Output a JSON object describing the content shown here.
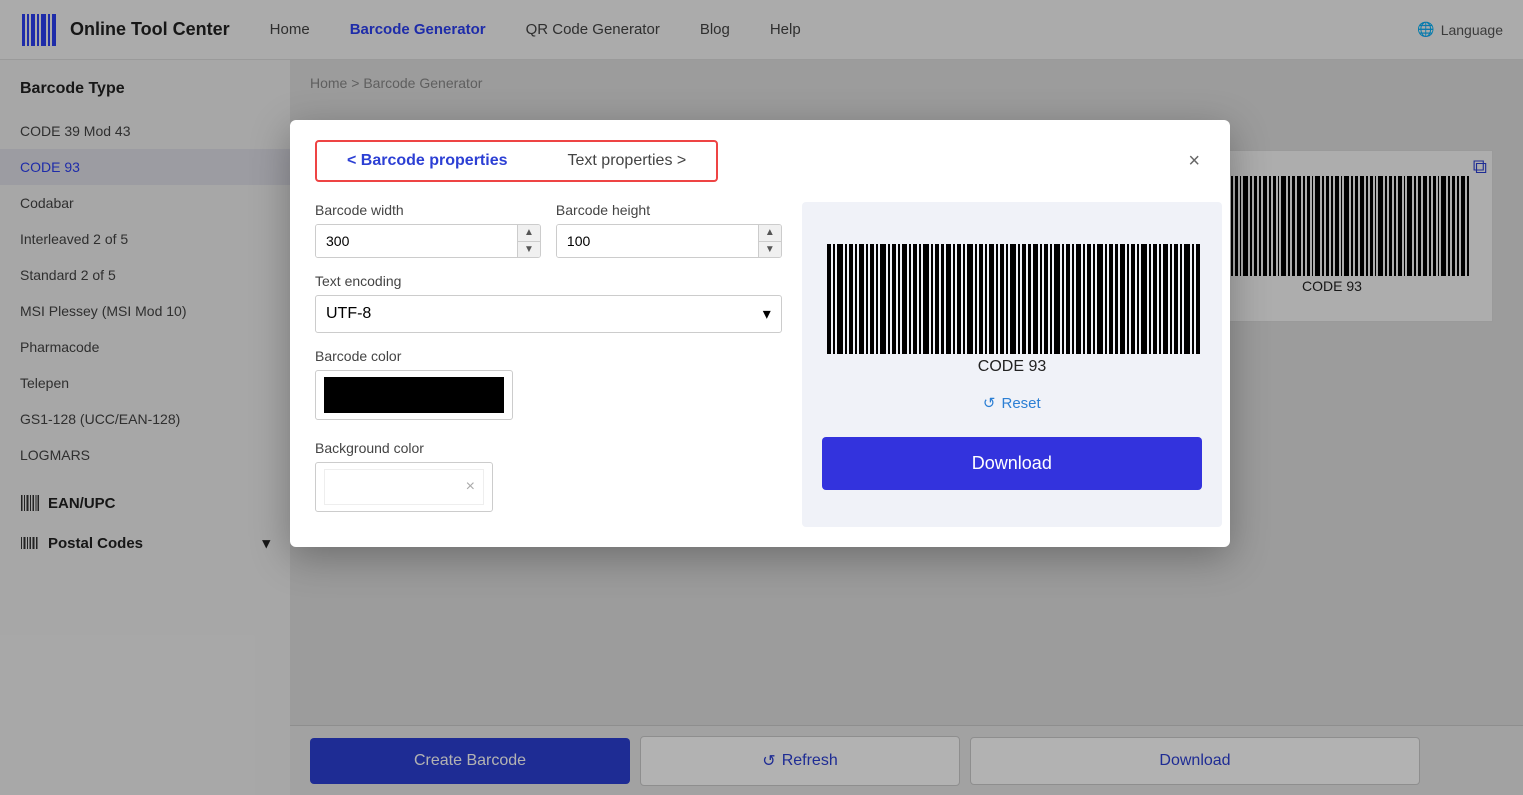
{
  "header": {
    "logo_text": "Online Tool Center",
    "nav": [
      {
        "label": "Home",
        "active": false
      },
      {
        "label": "Barcode Generator",
        "active": true
      },
      {
        "label": "QR Code Generator",
        "active": false
      },
      {
        "label": "Blog",
        "active": false
      },
      {
        "label": "Help",
        "active": false
      }
    ],
    "language_label": "Language"
  },
  "sidebar": {
    "title": "Barcode Type",
    "items": [
      {
        "label": "CODE 39 Mod 43",
        "active": false
      },
      {
        "label": "CODE 93",
        "active": true
      },
      {
        "label": "Codabar",
        "active": false
      },
      {
        "label": "Interleaved 2 of 5",
        "active": false
      },
      {
        "label": "Standard 2 of 5",
        "active": false
      },
      {
        "label": "MSI Plessey (MSI Mod 10)",
        "active": false
      },
      {
        "label": "Pharmacode",
        "active": false
      },
      {
        "label": "Telepen",
        "active": false
      },
      {
        "label": "GS1-128 (UCC/EAN-128)",
        "active": false
      },
      {
        "label": "LOGMARS",
        "active": false
      }
    ],
    "sections": [
      {
        "label": "EAN/UPC"
      },
      {
        "label": "Postal Codes",
        "has_arrow": true
      }
    ]
  },
  "breadcrumb": {
    "home": "Home",
    "separator": ">",
    "current": "Barcode Generator"
  },
  "modal": {
    "tab_barcode": "< Barcode properties",
    "tab_text": "Text properties >",
    "close_label": "×",
    "barcode_width_label": "Barcode width",
    "barcode_width_value": "300",
    "barcode_height_label": "Barcode height",
    "barcode_height_value": "100",
    "text_encoding_label": "Text encoding",
    "text_encoding_value": "UTF-8",
    "barcode_color_label": "Barcode color",
    "background_color_label": "Background color",
    "bg_clear_icon": "×",
    "barcode_name": "CODE 93",
    "reset_label": "Reset",
    "download_label": "Download"
  },
  "bottom_bar": {
    "create_label": "Create Barcode",
    "refresh_label": "Refresh",
    "download_label": "Download"
  },
  "icons": {
    "refresh": "↺",
    "reset": "↺",
    "globe": "🌐",
    "copy": "⧉",
    "barcode_logo": "|||"
  }
}
